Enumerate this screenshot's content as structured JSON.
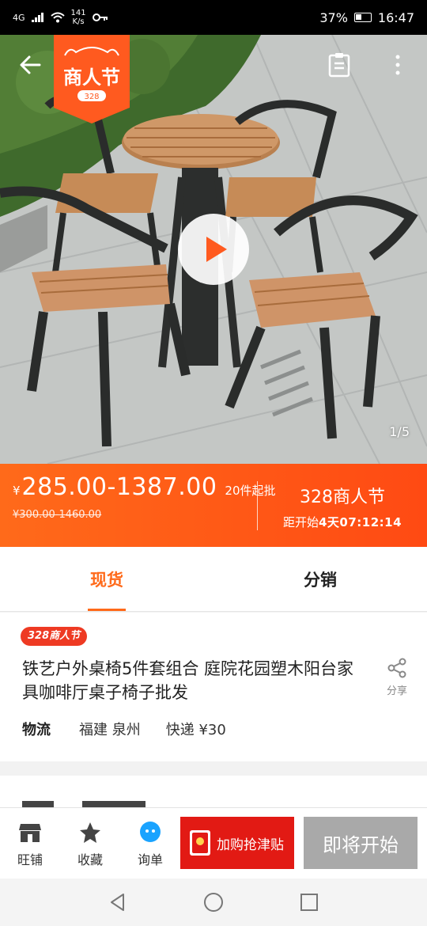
{
  "status_bar": {
    "network": "4G",
    "speed_value": "141",
    "speed_unit": "K/s",
    "battery": "37%",
    "time": "16:47"
  },
  "hero": {
    "badge_title": "商人节",
    "badge_sub": "328",
    "image_counter": "1/5",
    "icons": [
      "back-arrow-icon",
      "clipboard-icon",
      "more-vertical-icon",
      "play-icon"
    ]
  },
  "price": {
    "currency": "¥",
    "range": "285.00-1387.00",
    "min_order": "20件起批",
    "original": "¥300.00-1460.00",
    "event_name": "328商人节",
    "countdown_label": "距开始",
    "countdown_value": "4天07:12:14"
  },
  "tabs": [
    {
      "label": "现货",
      "active": true
    },
    {
      "label": "分销",
      "active": false
    }
  ],
  "product": {
    "promo_tag": "328商人节",
    "title": "铁艺户外桌椅5件套组合 庭院花园塑木阳台家具咖啡厅桌子椅子批发",
    "share_label": "分享",
    "logistics_label": "物流",
    "logistics_location": "福建 泉州",
    "logistics_shipping": "快递 ¥30"
  },
  "bottom_bar": {
    "shop_label": "旺铺",
    "favorite_label": "收藏",
    "inquiry_label": "询单",
    "subsidy_label": "加购抢津贴",
    "start_label": "即将开始"
  },
  "colors": {
    "accent": "#ff6a1a",
    "promo_red": "#e21a14",
    "disabled_gray": "#a9a9a9"
  }
}
